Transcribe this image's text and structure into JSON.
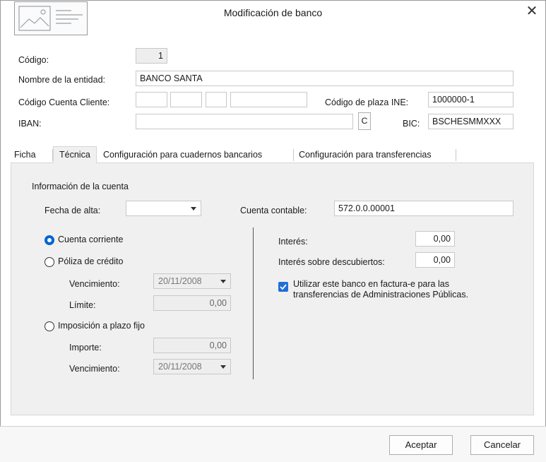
{
  "window": {
    "title": "Modificación de banco",
    "close_glyph": "✕"
  },
  "logo_icon": "image-placeholder-icon",
  "form": {
    "codigo_label": "Código:",
    "codigo_value": "1",
    "nombre_label": "Nombre de la entidad:",
    "nombre_value": "BANCO SANTA",
    "ccc_label": "Código Cuenta Cliente:",
    "plaza_label": "Código de plaza INE:",
    "plaza_value": "1000000-1",
    "iban_label": "IBAN:",
    "iban_value": "",
    "c_button": "C",
    "bic_label": "BIC:",
    "bic_value": "BSCHESMMXXX"
  },
  "tabs": [
    {
      "label": "Ficha",
      "selected": false
    },
    {
      "label": "Técnica",
      "selected": true
    },
    {
      "label": "Configuración para cuadernos bancarios",
      "selected": false
    },
    {
      "label": "Configuración para transferencias",
      "selected": false
    }
  ],
  "tecnica": {
    "section_title": "Información de la cuenta",
    "fecha_alta_label": "Fecha de alta:",
    "fecha_alta_value": "",
    "cuenta_contable_label": "Cuenta contable:",
    "cuenta_contable_value": "572.0.0.00001",
    "radio_cuenta_corriente": "Cuenta corriente",
    "radio_poliza": "Póliza de crédito",
    "poliza_vencimiento_label": "Vencimiento:",
    "poliza_vencimiento_value": "20/11/2008",
    "limite_label": "Límite:",
    "limite_value": "0,00",
    "radio_imposicion": "Imposición a plazo fijo",
    "importe_label": "Importe:",
    "importe_value": "0,00",
    "imposicion_vencimiento_label": "Vencimiento:",
    "imposicion_vencimiento_value": "20/11/2008",
    "interes_label": "Interés:",
    "interes_value": "0,00",
    "interes_desc_label": "Interés sobre descubiertos:",
    "interes_desc_value": "0,00",
    "utilizar_line1": "Utilizar este banco en factura-e para las",
    "utilizar_line2": "transferencias de Administraciones Públicas.",
    "accent_color": "#0066cc"
  },
  "footer": {
    "accept": "Aceptar",
    "cancel": "Cancelar"
  }
}
